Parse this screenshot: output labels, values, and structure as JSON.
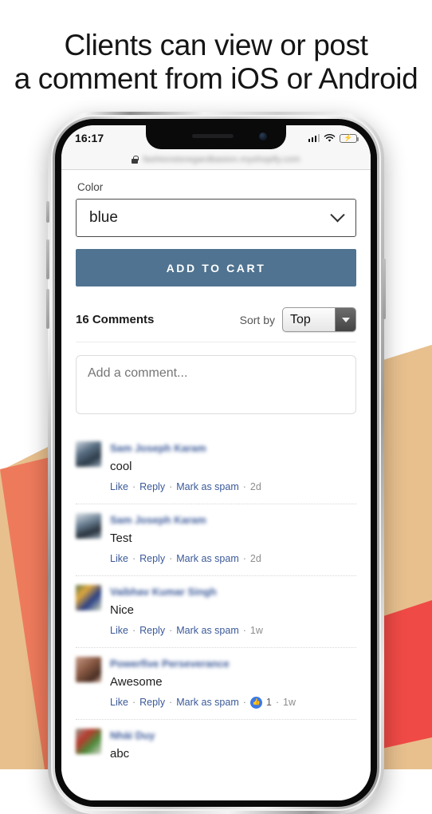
{
  "headline": {
    "line1": "Clients can view or post",
    "line2": "a comment from iOS or Android"
  },
  "colors": {
    "accent_button": "#4f7390",
    "link_blue": "#3b5998",
    "like_badge_blue": "#3b7ae4",
    "bg_tan": "#e8c08e",
    "bg_salmon": "#ee7a5c",
    "bg_red": "#f04a46",
    "battery_green": "#2fd158"
  },
  "phone": {
    "statusbar": {
      "time": "16:17",
      "signal_icon": "cellular-signal-icon",
      "wifi_icon": "wifi-icon",
      "battery_icon": "battery-charging-icon"
    },
    "urlbar": {
      "lock_icon": "lock-icon",
      "url": "fashionstoregardbasion.myshopify.com"
    }
  },
  "product": {
    "color_label": "Color",
    "color_value": "blue",
    "color_dropdown_icon": "chevron-down-icon",
    "add_to_cart_label": "ADD TO CART"
  },
  "comments_section": {
    "count_label": "16 Comments",
    "sort_by_label": "Sort by",
    "sort_value": "Top",
    "sort_dropdown_icon": "triangle-down-icon",
    "composer_placeholder": "Add a comment...",
    "composer_value": "",
    "actions": {
      "like": "Like",
      "reply": "Reply",
      "spam": "Mark as spam",
      "separator": "·"
    },
    "items": [
      {
        "name": "Sam Joseph Karam",
        "text": "cool",
        "time": "2d",
        "likes": "",
        "avatar": "av1"
      },
      {
        "name": "Sam Joseph Karam",
        "text": "Test",
        "time": "2d",
        "likes": "",
        "avatar": "av2"
      },
      {
        "name": "Vaibhav Kumar Singh",
        "text": "Nice",
        "time": "1w",
        "likes": "",
        "avatar": "av3"
      },
      {
        "name": "Powerfive Perseverance",
        "text": "Awesome",
        "time": "1w",
        "likes": "1",
        "like_icon": "thumbs-up-icon",
        "avatar": "av4"
      },
      {
        "name": "Nhài Duy",
        "text": "abc",
        "time": "",
        "likes": "",
        "avatar": "av5"
      }
    ]
  }
}
